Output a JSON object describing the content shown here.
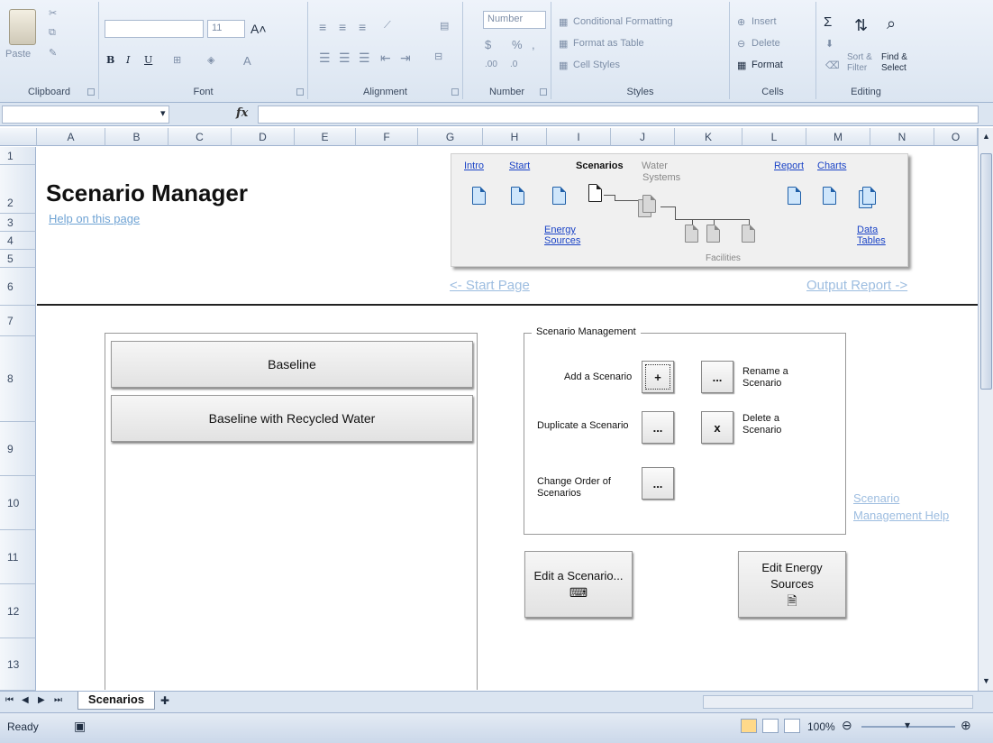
{
  "ribbon": {
    "clipboard": {
      "paste": "Paste",
      "label": "Clipboard"
    },
    "font": {
      "label": "Font",
      "size": "11",
      "bold": "B",
      "italic": "I",
      "underline": "U"
    },
    "alignment": {
      "label": "Alignment"
    },
    "number": {
      "label": "Number",
      "format": "Number",
      "currency": "$",
      "percent": "%",
      "comma": ","
    },
    "styles": {
      "label": "Styles",
      "conditional": "Conditional Formatting",
      "table": "Format as Table",
      "cell": "Cell Styles"
    },
    "cells": {
      "label": "Cells",
      "insert": "Insert",
      "delete": "Delete",
      "format": "Format"
    },
    "editing": {
      "label": "Editing",
      "sum": "Σ",
      "sort": "Sort & Filter",
      "find": "Find & Select"
    }
  },
  "formula": {
    "fx": "fx"
  },
  "columns": [
    "A",
    "B",
    "C",
    "D",
    "E",
    "F",
    "G",
    "H",
    "I",
    "J",
    "K",
    "L",
    "M",
    "N",
    "O"
  ],
  "rows": [
    "1",
    "2",
    "3",
    "4",
    "5",
    "6",
    "7",
    "8",
    "9",
    "10",
    "11",
    "12",
    "13"
  ],
  "page": {
    "title": "Scenario Manager",
    "help_link": "Help on this page",
    "start_link": "<- Start Page",
    "output_link": "Output Report ->"
  },
  "flow": {
    "intro": "Intro",
    "start": "Start",
    "scenarios": "Scenarios",
    "water": "Water",
    "systems": "Systems",
    "report": "Report",
    "charts": "Charts",
    "energy": "Energy",
    "sources": "Sources",
    "data": "Data",
    "tables": "Tables",
    "facilities": "Facilities"
  },
  "scenarios": [
    "Baseline",
    "Baseline with Recycled Water"
  ],
  "management": {
    "legend": "Scenario Management",
    "add_label": "Add a Scenario",
    "add_btn": "+",
    "rename_btn": "...",
    "rename_label": "Rename a Scenario",
    "duplicate_label": "Duplicate a Scenario",
    "duplicate_btn": "...",
    "delete_btn": "x",
    "delete_label": "Delete a Scenario",
    "order_label": "Change Order of Scenarios",
    "order_btn": "...",
    "help_link": "Scenario Management Help"
  },
  "actions": {
    "edit_scenario": "Edit a Scenario...",
    "edit_scenario_icon": "⌨",
    "edit_energy": "Edit Energy Sources",
    "edit_energy_icon": "🗎"
  },
  "footer": {
    "sheet_tab": "Scenarios",
    "status": "Ready",
    "zoom": "100%"
  }
}
